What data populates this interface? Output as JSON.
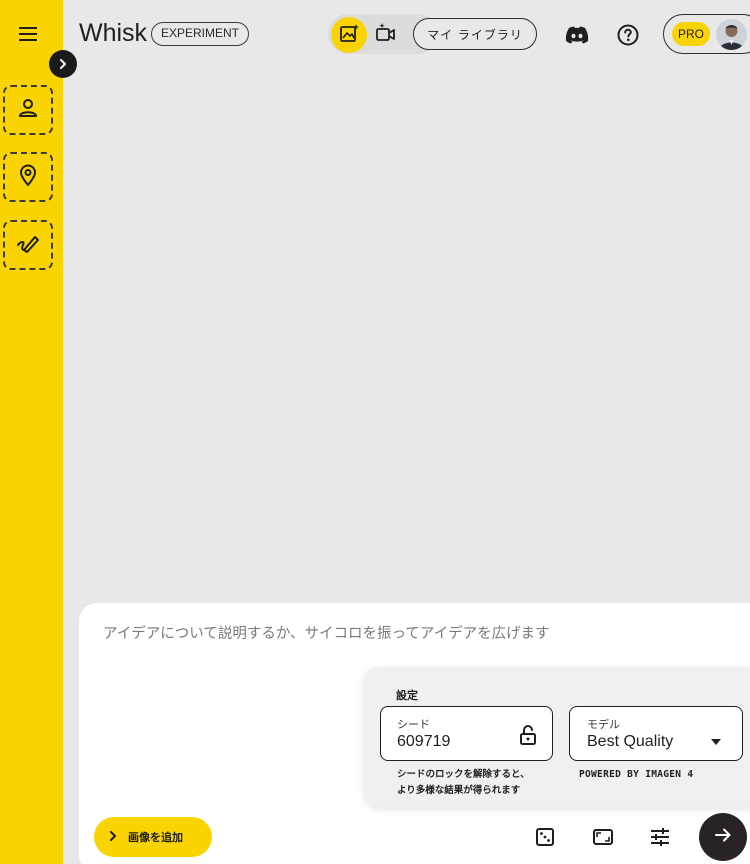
{
  "app": {
    "logo_text": "Whisk",
    "badge": "EXPERIMENT"
  },
  "header": {
    "library_label": "マイ ライブラリ",
    "pro_label": "PRO"
  },
  "prompt": {
    "placeholder": "アイデアについて説明するか、サイコロを振ってアイデアを広げます",
    "add_image_label": "画像を追加"
  },
  "settings": {
    "title": "設定",
    "seed_label": "シード",
    "seed_value": "609719",
    "seed_help_line1": "シードのロックを解除すると、",
    "seed_help_line2": "より多様な結果が得られます",
    "model_label": "モデル",
    "model_value": "Best Quality",
    "powered_by": "POWERED BY IMAGEN 4"
  },
  "icons": {
    "menu": "hamburger-icon",
    "expand": "chevron-right-icon",
    "subject": "person-icon",
    "scene": "location-pin-icon",
    "style": "brush-icon",
    "image_mode": "image-sparkle-icon",
    "video_mode": "video-sparkle-icon",
    "discord": "discord-icon",
    "help": "help-icon",
    "lock": "unlock-icon",
    "dropdown": "caret-down-icon",
    "dice": "dice-icon",
    "aspect": "aspect-ratio-icon",
    "tune": "tune-icon",
    "send": "arrow-right-icon"
  },
  "colors": {
    "accent_yellow": "#f9d400",
    "background": "#e8e8e8",
    "send_button": "#2a2326"
  }
}
